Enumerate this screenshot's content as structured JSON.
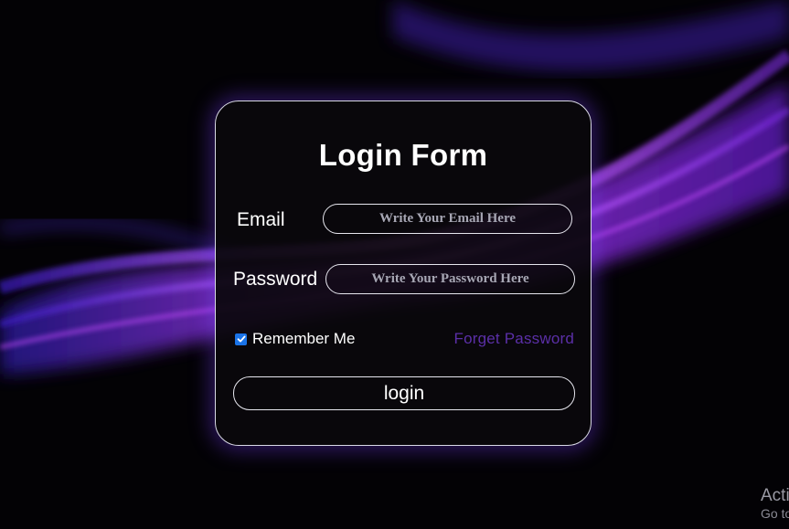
{
  "form": {
    "title": "Login Form",
    "email_label": "Email",
    "email_placeholder": "Write Your Email Here",
    "password_label": "Password",
    "password_placeholder": "Write Your Password Here",
    "remember_label": "Remember Me",
    "remember_checked": true,
    "forget_label": "Forget Password",
    "login_label": "login"
  },
  "watermark": {
    "line1": "Acti",
    "line2": "Go to"
  },
  "colors": {
    "accent_link": "#5b2fa8",
    "checkbox": "#1a73e8",
    "glow": "#7c3cff"
  },
  "icons": {
    "checkbox": "check-icon"
  }
}
